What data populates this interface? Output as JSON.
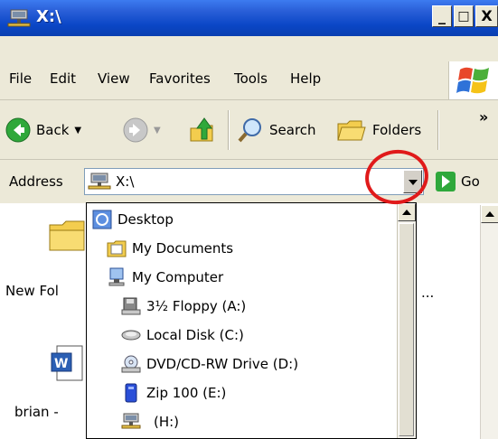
{
  "window": {
    "title": "X:\\",
    "controls": {
      "minimize": "_",
      "maximize": "□",
      "close": "X"
    }
  },
  "menu": {
    "items": [
      {
        "label": "File"
      },
      {
        "label": "Edit"
      },
      {
        "label": "View"
      },
      {
        "label": "Favorites"
      },
      {
        "label": "Tools"
      },
      {
        "label": "Help"
      }
    ]
  },
  "toolbar": {
    "back_label": "Back",
    "search_label": "Search",
    "folders_label": "Folders",
    "overflow_label": "»"
  },
  "address": {
    "label": "Address",
    "value": "X:\\",
    "go_label": "Go"
  },
  "content": {
    "items": [
      {
        "label": "New Fol",
        "icon": "folder-icon"
      },
      {
        "label": "brian -",
        "icon": "word-document-icon"
      }
    ],
    "right_fragment": "..."
  },
  "dropdown": {
    "items": [
      {
        "label": "Desktop",
        "icon": "desktop-icon",
        "level": 0
      },
      {
        "label": "My Documents",
        "icon": "my-documents-icon",
        "level": 1
      },
      {
        "label": "My Computer",
        "icon": "my-computer-icon",
        "level": 1
      },
      {
        "label": "3½ Floppy (A:)",
        "icon": "floppy-drive-icon",
        "level": 2
      },
      {
        "label": "Local Disk (C:)",
        "icon": "hard-disk-icon",
        "level": 2
      },
      {
        "label": "DVD/CD-RW Drive (D:)",
        "icon": "dvd-drive-icon",
        "level": 2
      },
      {
        "label": "Zip 100  (E:)",
        "icon": "zip-drive-icon",
        "level": 2
      },
      {
        "label": "(H:)",
        "icon": "network-drive-icon",
        "level": 2
      }
    ]
  },
  "colors": {
    "titlebar": "#0a46c6",
    "chrome": "#ece9d8",
    "annotation": "#e01a1a"
  }
}
